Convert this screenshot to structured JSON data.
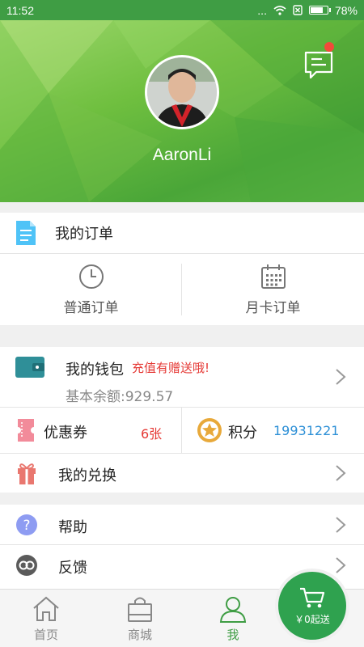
{
  "status_bar": {
    "time": "11:52",
    "dots": "...",
    "battery_text": "78%",
    "battery_level": 0.78
  },
  "profile": {
    "username": "AaronLi"
  },
  "orders": {
    "title": "我的订单",
    "items": [
      {
        "label": "普通订单",
        "icon": "clock-icon"
      },
      {
        "label": "月卡订单",
        "icon": "calendar-icon"
      }
    ]
  },
  "wallet": {
    "title": "我的钱包",
    "promo": "充值有赠送哦!",
    "balance": "基本余额:929.57"
  },
  "coupons": {
    "label": "优惠券",
    "count": "6张"
  },
  "points": {
    "label": "积分",
    "value": "19931221"
  },
  "exchange": {
    "label": "我的兑换"
  },
  "help": {
    "label": "帮助"
  },
  "feedback": {
    "label": "反馈"
  },
  "nav": {
    "items": [
      {
        "label": "首页",
        "icon": "home-icon"
      },
      {
        "label": "商城",
        "icon": "shop-bag-icon"
      },
      {
        "label": "我",
        "icon": "person-icon",
        "active": true
      }
    ],
    "cart": {
      "label": "￥0起送",
      "icon": "cart-icon"
    }
  },
  "colors": {
    "primary_green": "#3f9d44",
    "promo_red": "#e53935",
    "points_blue": "#2c8fd6",
    "cart_green": "#2fa24f"
  }
}
